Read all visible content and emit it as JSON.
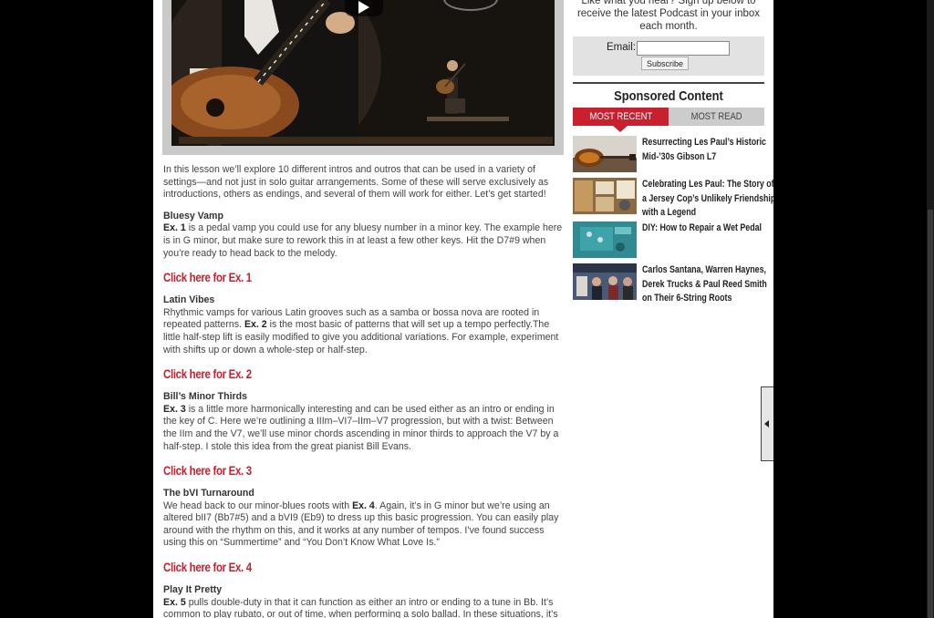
{
  "video": {
    "play_icon": "play-icon"
  },
  "article": {
    "intro": "In this lesson we’ll explore 10 different intros and outros that can be used in a variety of settings—and not just in solo guitar arrangements. Some of these will serve exclusively as introductions, others as endings, and several of them will work for either. Let’s get started!",
    "sections": [
      {
        "heading": "Bluesy Vamp",
        "ex_label": "Ex. 1",
        "body_before": "",
        "body": " is a pedal vamp you could use for any bluesy number in a minor key. The example here is in G minor, but make sure to rework this in at least a few other keys. Hit the D7#9 when you’re ready to head back to the melody.",
        "link": "Click here for Ex. 1"
      },
      {
        "heading": "Latin Vibes",
        "body_before": "Rhythmic vamps for various Latin grooves such as a samba or bossa nova are rooted in repeated patterns. ",
        "ex_label": "Ex. 2",
        "body": " is the most basic of patterns that will set up a tempo perfectly.The little half-step lift is easily modified to give you additional variations. For example, experiment with shifts up or down a whole-step or half-step.",
        "link": "Click here for Ex. 2"
      },
      {
        "heading": "Bill’s Minor Thirds",
        "ex_label": "Ex. 3",
        "body_before": "",
        "body": " is a little more harmonically interesting and can be used either as an intro or ending in the key of C. Here we’re outlining a IIIm–VI7–IIm–V7 progression, but with a twist: Between the IIm and the V7, we’ll use minor chords ascending in minor thirds to approach the V7 by a half-step. I stole this idea from the great pianist Bill Evans.",
        "link": "Click here for Ex. 3"
      },
      {
        "heading": "The bVI Turnaround",
        "body_before": "We head back to our minor-blues roots with ",
        "ex_label": "Ex. 4",
        "body": ". Again, it’s in G minor but we’re using an altered bII7 (Bb7#5) and a bVI9 (Eb9) to dress up this basic progression. You can easily play around with the rhythm on this, and it works at any number of tempos. I’ve found success using this on “Summertime” and “You Don’t Know What Love Is.”",
        "link": "Click here for Ex. 4"
      },
      {
        "heading": "Play It Pretty",
        "ex_label": "Ex. 5",
        "body_before": "",
        "body": " pulls double-duty in that it can function as either an intro or ending to a tune in Bb. It’s common to play rubato, or out of time, when performing a solo ballad. In these situations, it’s best to lightly arpeggiate the chords, so you will want a pretty chord progression. I’ve created a pattern here",
        "link": ""
      }
    ]
  },
  "sidebar": {
    "podcast_text": "Like what you hear? Sign up below to receive the latest Podcast in your inbox each month.",
    "email_label": "Email:",
    "email_value": "",
    "subscribe_label": "Subscribe",
    "sponsored_title": "Sponsored Content",
    "tabs": {
      "recent": "MOST RECENT",
      "read": "MOST READ"
    },
    "news": [
      {
        "title": "Resurrecting Les Paul’s Historic Mid-’30s Gibson L7"
      },
      {
        "title": "Celebrating Les Paul: The Story of a Jersey Cop’s Unlikely Friendship with a Legend"
      },
      {
        "title": "DIY: How to Repair a Wet Pedal"
      },
      {
        "title": "Carlos Santana, Warren Haynes, Derek Trucks & Paul Reed Smith on Their 6-String Roots"
      }
    ]
  },
  "colors": {
    "accent": "#c8202f",
    "tab_inactive": "#cccccc"
  }
}
